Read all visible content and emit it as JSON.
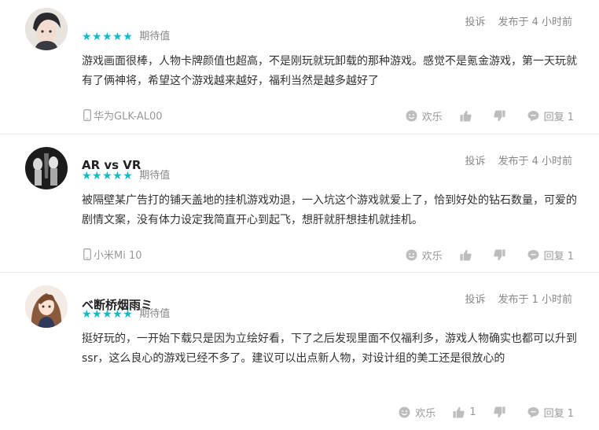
{
  "reviews": [
    {
      "name": "",
      "stars": "★★★★★",
      "rating_label": "期待值",
      "report": "投诉",
      "time": "发布于 4 小时前",
      "content": "游戏画面很棒，人物卡牌颜值也超高，不是刚玩就玩卸载的那种游戏。感觉不是氪金游戏，第一天玩就有了俩神将，希望这个游戏越来越好，福利当然是越多越好了",
      "device": "华为GLK-AL00",
      "happy": "欢乐",
      "like_count": "",
      "reply": "回复 1"
    },
    {
      "name": "AR vs VR",
      "stars": "★★★★★",
      "rating_label": "期待值",
      "report": "投诉",
      "time": "发布于 4 小时前",
      "content": "被隔壁某广告打的铺天盖地的挂机游戏劝退，一入坑这个游戏就爱上了，恰到好处的钻石数量，可爱的剧情文案，没有体力设定我简直开心到起飞，想肝就肝想挂机就挂机。",
      "device": "小米Mi 10",
      "happy": "欢乐",
      "like_count": "",
      "reply": "回复 1"
    },
    {
      "name": "ベ断桥烟雨ミ",
      "stars": "★★★★★",
      "rating_label": "期待值",
      "report": "投诉",
      "time": "发布于 1 小时前",
      "content": "挺好玩的，一开始下载只是因为立绘好看，下了之后发现里面不仅福利多，游戏人物确实也都可以升到ssr，这么良心的游戏已经不多了。建议可以出点新人物，对设计组的美工还是很放心的",
      "device": "",
      "happy": "欢乐",
      "like_count": "1",
      "reply": "回复 1"
    }
  ],
  "colors": {
    "star": "#14b9c8",
    "meta": "#888888",
    "icon": "#bdbdbd"
  }
}
